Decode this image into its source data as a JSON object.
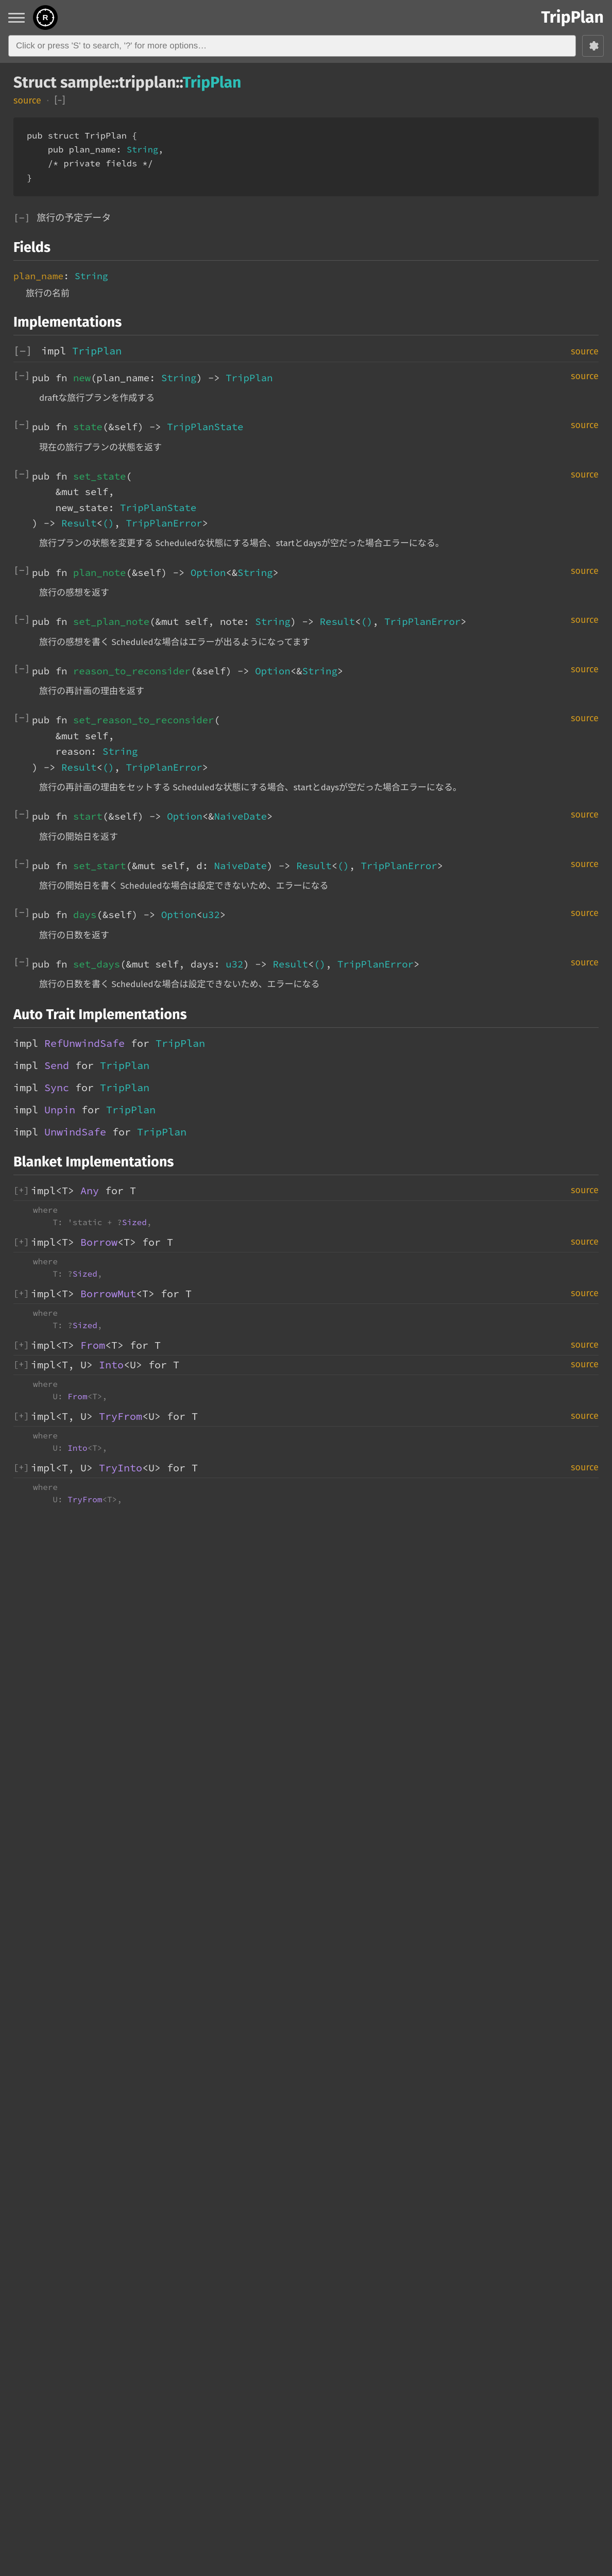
{
  "crate_name": "TripPlan",
  "search_placeholder": "Click or press 'S' to search, '?' for more options…",
  "title_prefix": "Struct ",
  "title_path": "sample::tripplan::",
  "title_name": "TripPlan",
  "source_label": "source",
  "collapse_label": "[−]",
  "struct_def": {
    "line1": "pub struct TripPlan {",
    "line2_label": "    pub plan_name: ",
    "line2_type": "String",
    "line2_end": ",",
    "line3": "    /* private fields */",
    "line4": "}"
  },
  "expand_desc_label": "[−]",
  "expand_desc": "旅行の予定データ",
  "section_fields": "Fields",
  "field": {
    "name": "plan_name",
    "sep": ": ",
    "type": "String",
    "desc": "旅行の名前"
  },
  "section_impl": "Implementations",
  "impl_header": {
    "kw": "impl ",
    "type": "TripPlan"
  },
  "methods": [
    {
      "sig_html": "pub fn <fn>new</fn>(plan_name: <ty>String</ty>) -> <ty>TripPlan</ty>",
      "desc": "draftな旅行プランを作成する"
    },
    {
      "sig_html": "pub fn <fn>state</fn>(&self) -> <ty>TripPlanState</ty>",
      "desc": "現在の旅行プランの状態を返す"
    },
    {
      "sig_html": "pub fn <fn>set_state</fn>(\n    &mut self,\n    new_state: <ty>TripPlanState</ty>\n) -> <ty>Result</ty><<ty>()</ty>, <ty>TripPlanError</ty>>",
      "desc": "旅行プランの状態を変更する Scheduledな状態にする場合、startとdaysが空だった場合エラーになる。"
    },
    {
      "sig_html": "pub fn <fn>plan_note</fn>(&self) -> <ty>Option</ty><&<ty>String</ty>>",
      "desc": "旅行の感想を返す"
    },
    {
      "sig_html": "pub fn <fn>set_plan_note</fn>(&mut self, note: <ty>String</ty>) -> <ty>Result</ty><<ty>()</ty>, <ty>TripPlanError</ty>>",
      "desc": "旅行の感想を書く Scheduledな場合はエラーが出るようになってます"
    },
    {
      "sig_html": "pub fn <fn>reason_to_reconsider</fn>(&self) -> <ty>Option</ty><&<ty>String</ty>>",
      "desc": "旅行の再計画の理由を返す"
    },
    {
      "sig_html": "pub fn <fn>set_reason_to_reconsider</fn>(\n    &mut self,\n    reason: <ty>String</ty>\n) -> <ty>Result</ty><<ty>()</ty>, <ty>TripPlanError</ty>>",
      "desc": "旅行の再計画の理由をセットする Scheduledな状態にする場合、startとdaysが空だった場合エラーになる。"
    },
    {
      "sig_html": "pub fn <fn>start</fn>(&self) -> <ty>Option</ty><&<ty>NaiveDate</ty>>",
      "desc": "旅行の開始日を返す"
    },
    {
      "sig_html": "pub fn <fn>set_start</fn>(&mut self, d: <ty>NaiveDate</ty>) -> <ty>Result</ty><<ty>()</ty>, <ty>TripPlanError</ty>>",
      "desc": "旅行の開始日を書く Scheduledな場合は設定できないため、エラーになる"
    },
    {
      "sig_html": "pub fn <fn>days</fn>(&self) -> <ty>Option</ty><<ty>u32</ty>>",
      "desc": "旅行の日数を返す"
    },
    {
      "sig_html": "pub fn <fn>set_days</fn>(&mut self, days: <ty>u32</ty>) -> <ty>Result</ty><<ty>()</ty>, <ty>TripPlanError</ty>>",
      "desc": "旅行の日数を書く Scheduledな場合は設定できないため、エラーになる"
    }
  ],
  "section_auto": "Auto Trait Implementations",
  "auto_impls": [
    {
      "kw": "impl ",
      "trait": "RefUnwindSafe",
      "mid": " for ",
      "type": "TripPlan"
    },
    {
      "kw": "impl ",
      "trait": "Send",
      "mid": " for ",
      "type": "TripPlan"
    },
    {
      "kw": "impl ",
      "trait": "Sync",
      "mid": " for ",
      "type": "TripPlan"
    },
    {
      "kw": "impl ",
      "trait": "Unpin",
      "mid": " for ",
      "type": "TripPlan"
    },
    {
      "kw": "impl ",
      "trait": "UnwindSafe",
      "mid": " for ",
      "type": "TripPlan"
    }
  ],
  "section_blanket": "Blanket Implementations",
  "blankets": [
    {
      "head_html": "impl<T> <tr>Any</tr> for T",
      "where": "where\n    T: 'static + ?<tr>Sized</tr>,"
    },
    {
      "head_html": "impl<T> <tr>Borrow</tr><T> for T",
      "where": "where\n    T: ?<tr>Sized</tr>,"
    },
    {
      "head_html": "impl<T> <tr>BorrowMut</tr><T> for T",
      "where": "where\n    T: ?<tr>Sized</tr>,"
    },
    {
      "head_html": "impl<T> <tr>From</tr><T> for T",
      "where": ""
    },
    {
      "head_html": "impl<T, U> <tr>Into</tr><U> for T",
      "where": "where\n    U: <tr>From</tr><T>,"
    },
    {
      "head_html": "impl<T, U> <tr>TryFrom</tr><U> for T",
      "where": "where\n    U: <tr>Into</tr><T>,"
    },
    {
      "head_html": "impl<T, U> <tr>TryInto</tr><U> for T",
      "where": "where\n    U: <tr>TryFrom</tr><T>,"
    }
  ],
  "tgl_collapse": "[−]",
  "tgl_expand": "[+]"
}
